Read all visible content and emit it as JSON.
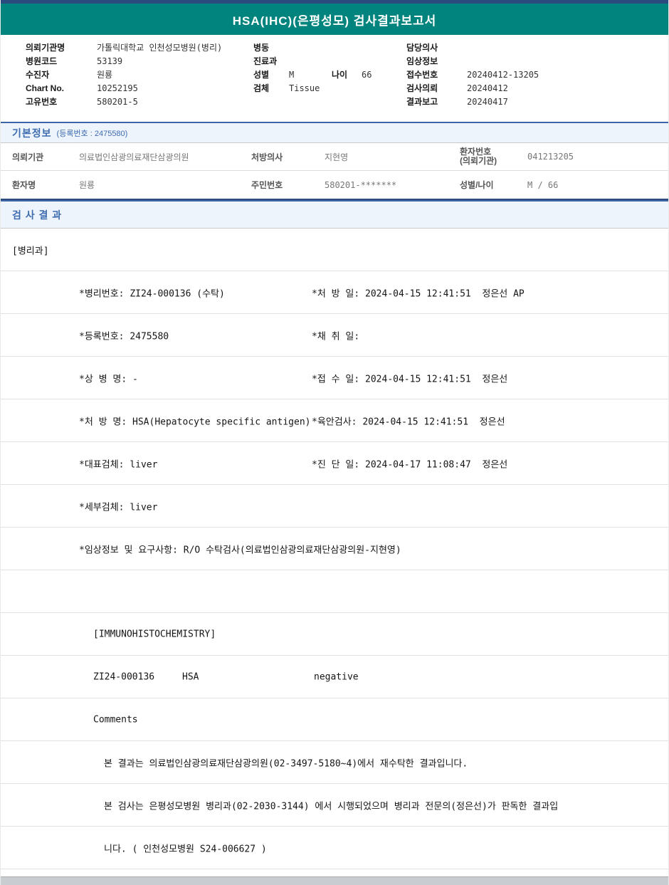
{
  "report": {
    "title": "HSA(IHC)(은평성모) 검사결과보고서"
  },
  "patient_block": {
    "col1": [
      {
        "label": "의뢰기관명",
        "value": "가톨릭대학교 인천성모병원(병리)"
      },
      {
        "label": "병원코드",
        "value": "53139"
      },
      {
        "label": "수진자",
        "value": "원룡"
      },
      {
        "label": "Chart No.",
        "value": "10252195"
      },
      {
        "label": "고유번호",
        "value": "580201-5"
      }
    ],
    "col2": [
      {
        "label": "병동",
        "value": ""
      },
      {
        "label": "진료과",
        "value": ""
      },
      {
        "label": "성별",
        "value": "M",
        "label2": "나이",
        "value2": "66"
      },
      {
        "label": "검체",
        "value": "Tissue"
      }
    ],
    "col3": [
      {
        "label": "담당의사",
        "value": ""
      },
      {
        "label": "임상정보",
        "value": ""
      },
      {
        "label": "접수번호",
        "value": "20240412-13205"
      },
      {
        "label": "검사의뢰",
        "value": "20240412"
      },
      {
        "label": "결과보고",
        "value": "20240417"
      }
    ]
  },
  "basic_info": {
    "section_title": "기본정보",
    "section_sub": "(등록번호 : 2475580)",
    "row1": {
      "l1": "의뢰기관",
      "v1": "의료법인삼광의료재단삼광의원",
      "l2": "처방의사",
      "v2": "지현영",
      "l3": "환자번호",
      "l3b": "(의뢰기관)",
      "v3": "041213205"
    },
    "row2": {
      "l1": "환자명",
      "v1": "원룡",
      "l2": "주민번호",
      "v2": "580201-*******",
      "l3": "성별/나이",
      "v3": "M / 66"
    }
  },
  "results": {
    "section_title": "검 사 결 과",
    "dept": "[병리과]",
    "detail_rows": [
      {
        "left": "*병리번호: ZI24-000136 (수탁)",
        "right": "*처 방 일: 2024-04-15 12:41:51  정은선 AP"
      },
      {
        "left": "*등록번호: 2475580",
        "right": "*채 취 일:"
      },
      {
        "left": "*상 병 명: -",
        "right": "*접 수 일: 2024-04-15 12:41:51  정은선"
      },
      {
        "left": "*처 방 명: HSA(Hepatocyte specific antigen)",
        "right": "*육안검사: 2024-04-15 12:41:51  정은선"
      },
      {
        "left": "*대표검체: liver",
        "right": "*진 단 일: 2024-04-17 11:08:47  정은선"
      },
      {
        "left": "*세부검체: liver",
        "right": ""
      },
      {
        "left": "*임상정보 및 요구사항: R/O 수탁검사(의료법인삼광의료재단삼광의원-지현영)",
        "right": ""
      }
    ],
    "ihc_header": "[IMMUNOHISTOCHEMISTRY]",
    "ihc_row": {
      "code": "ZI24-000136",
      "test": "HSA",
      "value": "negative"
    },
    "comments_label": "Comments",
    "comment_lines": [
      "본 결과는 의료법인삼광의료재단삼광의원(02-3497-5180~4)에서 재수탁한 결과입니다.",
      "본 검사는 은평성모병원 병리과(02-2030-3144) 에서 시행되었으며 병리과 전문의(정은선)가 판독한 결과입",
      "니다. ( 인천성모병원 S24-006627 )"
    ]
  }
}
